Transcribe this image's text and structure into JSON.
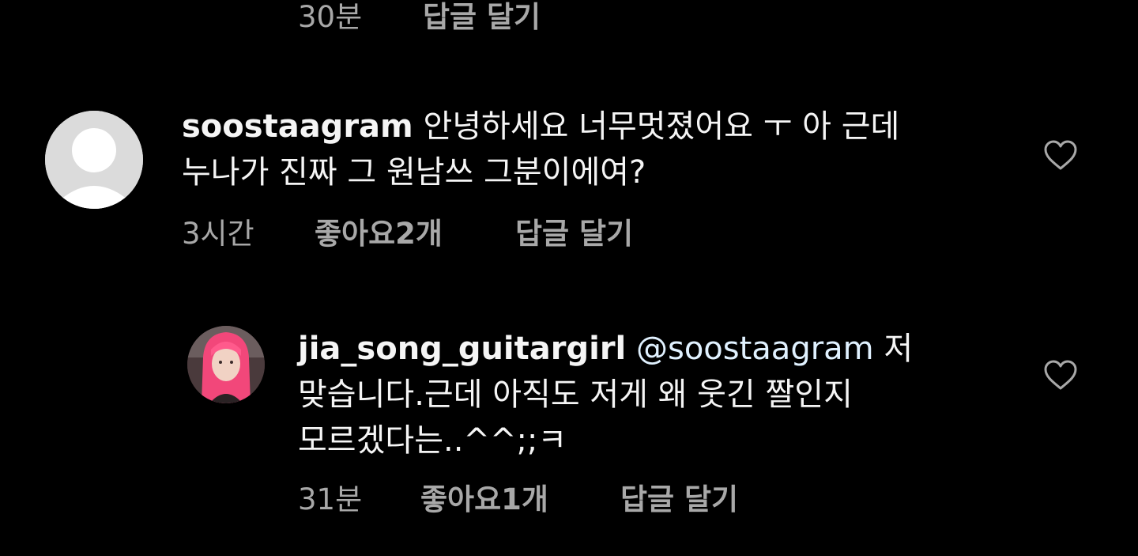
{
  "top_comment_meta": {
    "time": "30분",
    "reply": "답글 달기"
  },
  "comment_1": {
    "username": "soostaagram",
    "text_line1": "안녕하세요 너무멋졌어요 ㅜ 아 근데",
    "text_line2": "누나가 진짜 그 원남쓰 그분이에여?",
    "time": "3시간",
    "likes_prefix": "좋아요 ",
    "likes_count": "2개",
    "reply": "답글 달기",
    "avatar_icon": "default-person-icon",
    "like_icon": "heart-outline-icon"
  },
  "comment_2": {
    "username": "jia_song_guitargirl",
    "mention": "@soostaagram",
    "text_line1_rest": " 저",
    "text_line2": "맞습니다.근데 아직도 저게 왜 웃긴 짤인지",
    "text_line3": "모르겠다는..^^;;ㅋ",
    "time": "31분",
    "likes_prefix": "좋아요 ",
    "likes_count": "1개",
    "reply": "답글 달기",
    "avatar_icon": "profile-photo",
    "like_icon": "heart-outline-icon"
  },
  "colors": {
    "background": "#000000",
    "text": "#f5f5f5",
    "meta": "#a8a8a8",
    "mention": "#e0f1ff"
  }
}
